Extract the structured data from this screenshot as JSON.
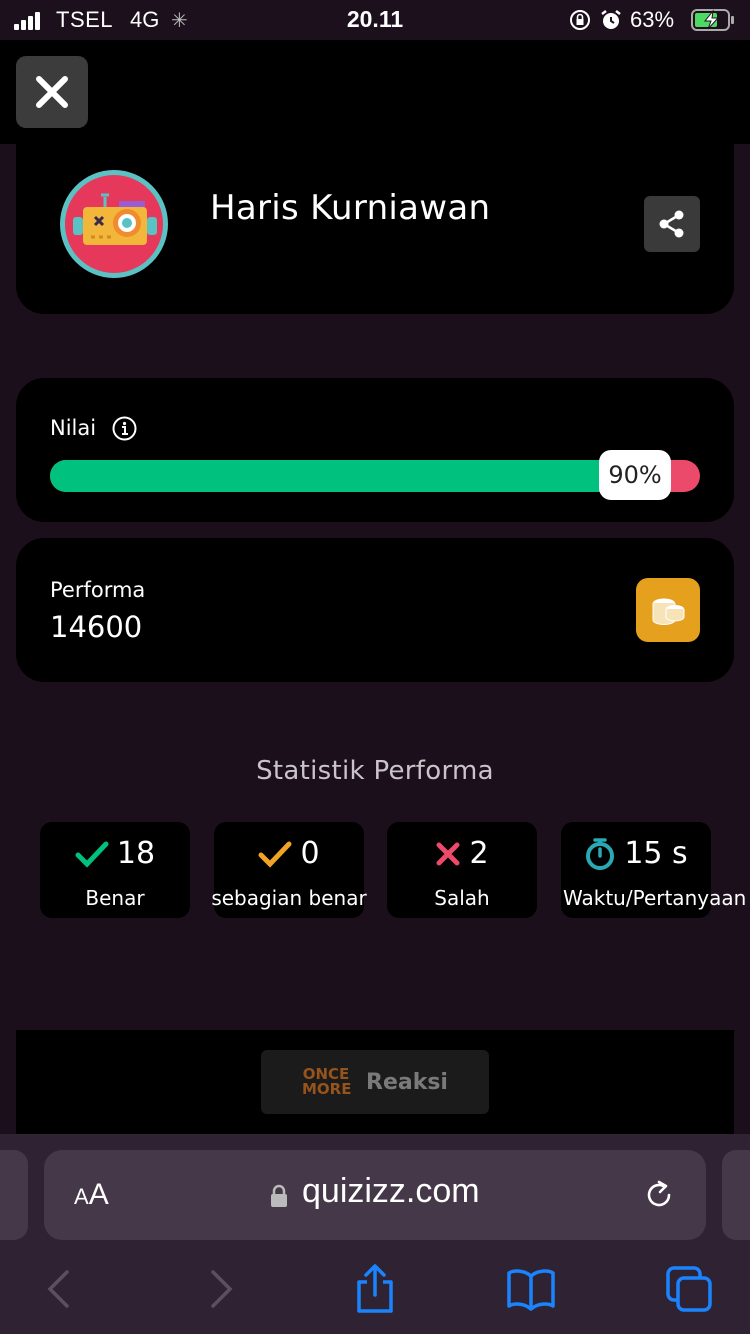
{
  "status_bar": {
    "carrier": "TSEL",
    "network": "4G",
    "time": "20.11",
    "battery": "63%"
  },
  "profile": {
    "name": "Haris Kurniawan"
  },
  "score": {
    "label": "Nilai",
    "percent_text": "90%",
    "percent": 90
  },
  "performance": {
    "label": "Performa",
    "value": "14600"
  },
  "stats": {
    "title": "Statistik Performa",
    "items": [
      {
        "value": "18",
        "label": "Benar",
        "icon": "check-icon",
        "color": "#00c17e"
      },
      {
        "value": "0",
        "label": "sebagian benar",
        "icon": "check-icon",
        "color": "#f0a324"
      },
      {
        "value": "2",
        "label": "Salah",
        "icon": "cross-icon",
        "color": "#ec4a6b"
      },
      {
        "value": "15 s",
        "label": "Waktu/Pertanyaan",
        "icon": "stopwatch-icon",
        "color": "#2aa8b3"
      }
    ]
  },
  "reaction": {
    "brand": "ONCE MORE",
    "label": "Reaksi"
  },
  "browser": {
    "aa_small": "A",
    "aa_big": "A",
    "url": "quizizz.com"
  },
  "colors": {
    "correct": "#00c17e",
    "incorrect": "#ec4a6b",
    "coin": "#e5a11d",
    "background": "#1c0f1c",
    "link_blue": "#1a84ff"
  }
}
